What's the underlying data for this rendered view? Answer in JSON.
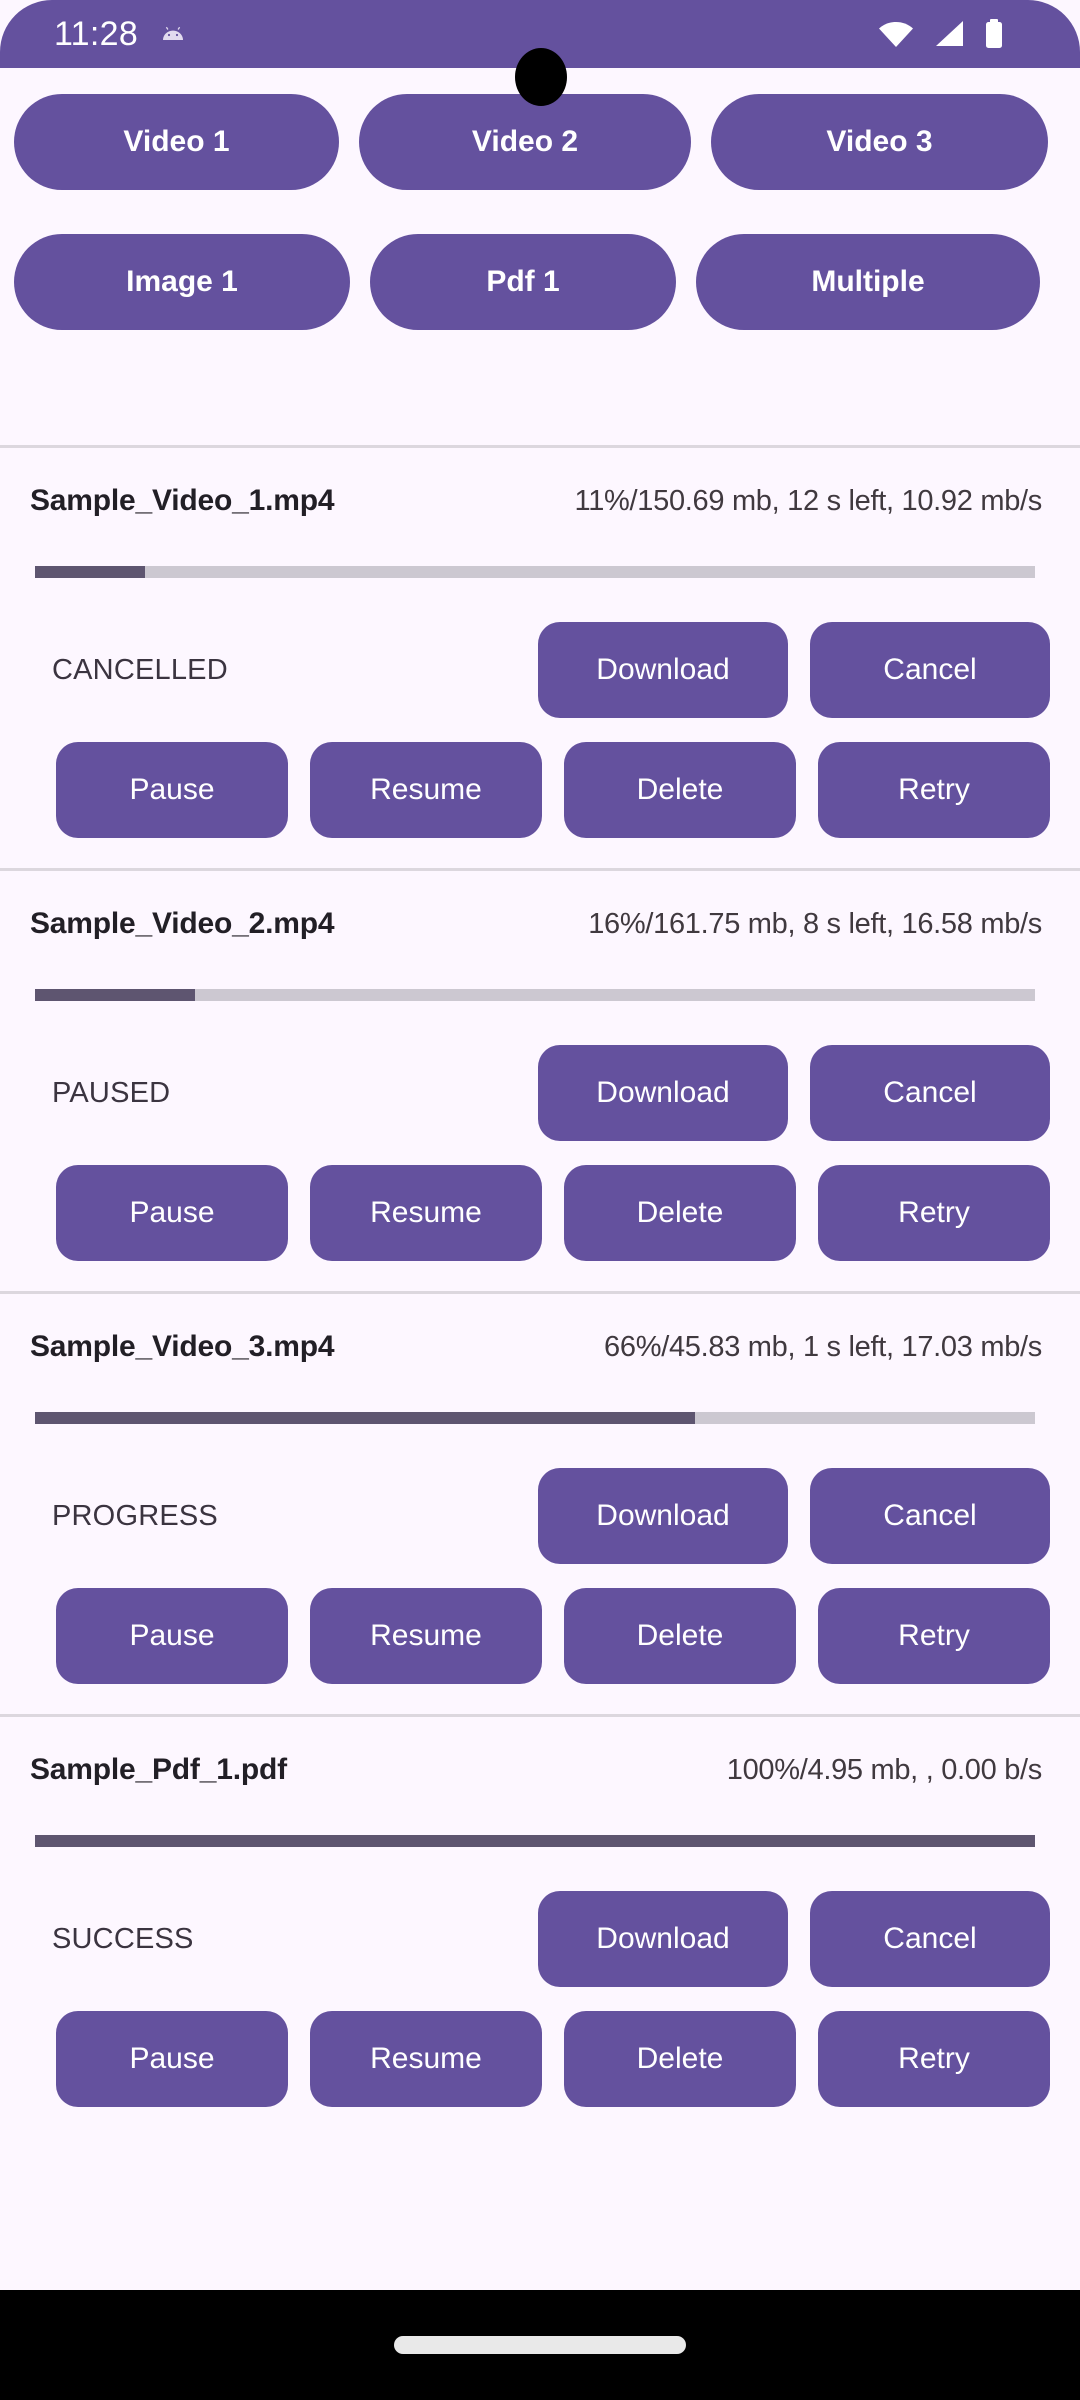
{
  "status_bar": {
    "time": "11:28",
    "icons": [
      "android-head-icon",
      "wifi-icon",
      "signal-icon",
      "battery-icon"
    ]
  },
  "theme": {
    "primary": "#64519E",
    "surface": "#FDF7FF",
    "on_surface": "#221F26",
    "progress_fill": "#5E5570",
    "progress_track": "#CCC8D1",
    "divider": "#DCD7DE",
    "nav_bar": "#000000"
  },
  "action_buttons": {
    "row1": [
      "Video 1",
      "Video 2",
      "Video 3"
    ],
    "row2": [
      "Image 1",
      "Pdf 1",
      "Multiple"
    ]
  },
  "common": {
    "download_label": "Download",
    "cancel_label": "Cancel",
    "pause_label": "Pause",
    "resume_label": "Resume",
    "delete_label": "Delete",
    "retry_label": "Retry"
  },
  "downloads": [
    {
      "file_name": "Sample_Video_1.mp4",
      "progress_text": "11%/150.69 mb, 12 s left, 10.92 mb/s",
      "percent": 11,
      "state": "CANCELLED"
    },
    {
      "file_name": "Sample_Video_2.mp4",
      "progress_text": "16%/161.75 mb, 8 s left, 16.58 mb/s",
      "percent": 16,
      "state": "PAUSED"
    },
    {
      "file_name": "Sample_Video_3.mp4",
      "progress_text": "66%/45.83 mb, 1 s left, 17.03 mb/s",
      "percent": 66,
      "state": "PROGRESS"
    },
    {
      "file_name": "Sample_Pdf_1.pdf",
      "progress_text": "100%/4.95 mb, , 0.00 b/s",
      "percent": 100,
      "state": "SUCCESS"
    }
  ]
}
